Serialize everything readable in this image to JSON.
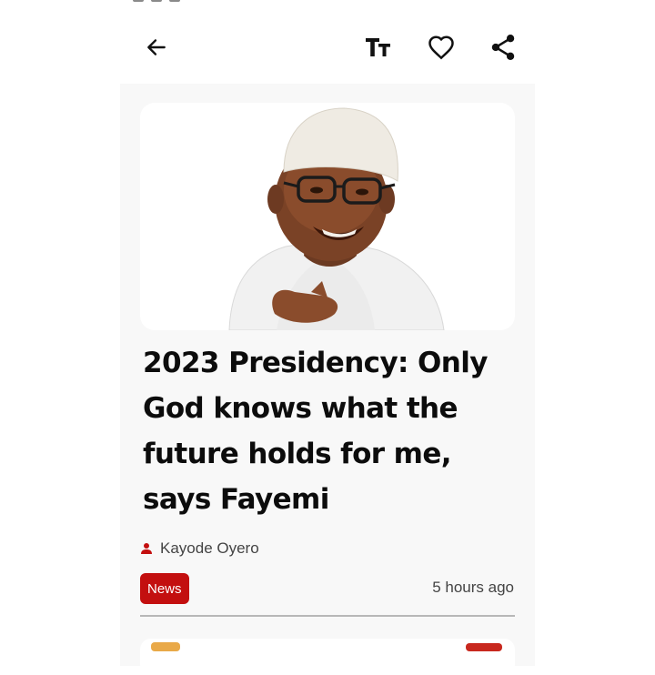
{
  "toolbar": {
    "back_icon": "arrow-left-icon",
    "text_size_icon": "text-size-icon",
    "text_size_label": "TT",
    "favorite_icon": "heart-outline-icon",
    "share_icon": "share-icon"
  },
  "article": {
    "title": "2023 Presidency: Only God knows what the future holds for me, says Fayemi",
    "author": "Kayode Oyero",
    "author_icon": "person-icon",
    "category": "News",
    "published": "5 hours ago"
  },
  "colors": {
    "accent": "#c30f0f",
    "background": "#f8f8f8",
    "card": "#ffffff"
  }
}
